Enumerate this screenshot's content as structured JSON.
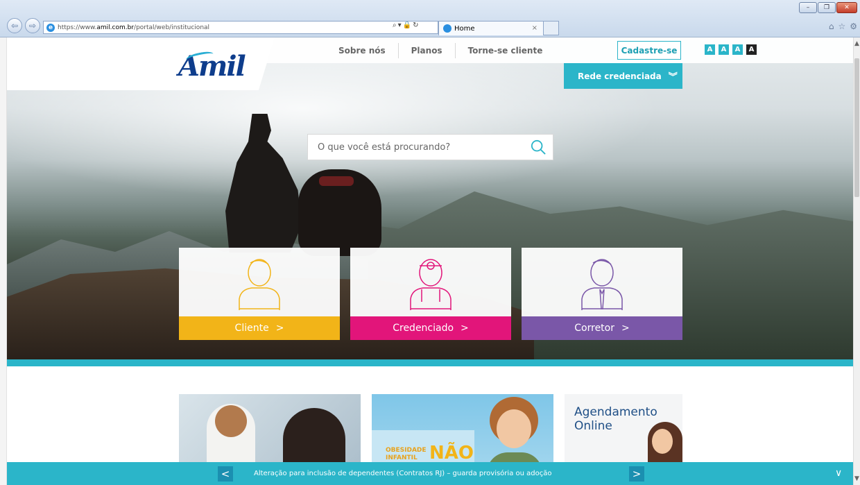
{
  "browser": {
    "url_prefix": "https://www.",
    "url_host": "amil.com.br",
    "url_path": "/portal/web/institucional",
    "tab_title": "Home",
    "tab_close": "×"
  },
  "header": {
    "logo_text": "Amil",
    "nav": [
      "Sobre nós",
      "Planos",
      "Torne-se cliente"
    ],
    "cadastre_label": "Cadastre-se",
    "font_buttons": [
      {
        "label": "A",
        "color": "#2bb5c9"
      },
      {
        "label": "A",
        "color": "#2bb5c9"
      },
      {
        "label": "A",
        "color": "#2bb5c9"
      },
      {
        "label": "A",
        "color": "#222222"
      }
    ],
    "rede_label": "Rede credenciada",
    "rede_icon": "chevron-down-icon"
  },
  "search": {
    "placeholder": "O que você está procurando?"
  },
  "cards": [
    {
      "label": "Cliente",
      "color": "#f2b418",
      "icon": "client-person-icon"
    },
    {
      "label": "Credenciado",
      "color": "#e2157a",
      "icon": "doctor-icon"
    },
    {
      "label": "Corretor",
      "color": "#7a57a8",
      "icon": "broker-icon"
    }
  ],
  "cards_arrow": ">",
  "promos": {
    "obesidade_line1": "OBESIDADE",
    "obesidade_line2": "INFANTIL",
    "nao": "NÃO",
    "agendamento_line1": "Agendamento",
    "agendamento_line2": "Online"
  },
  "ticker": {
    "text": "Alteração para inclusão de dependentes (Contratos RJ) – guarda provisória ou adoção",
    "prev": "<",
    "next": ">",
    "collapse": "∨"
  },
  "colors": {
    "teal": "#2bb5c9",
    "navy": "#0e3d8c"
  }
}
